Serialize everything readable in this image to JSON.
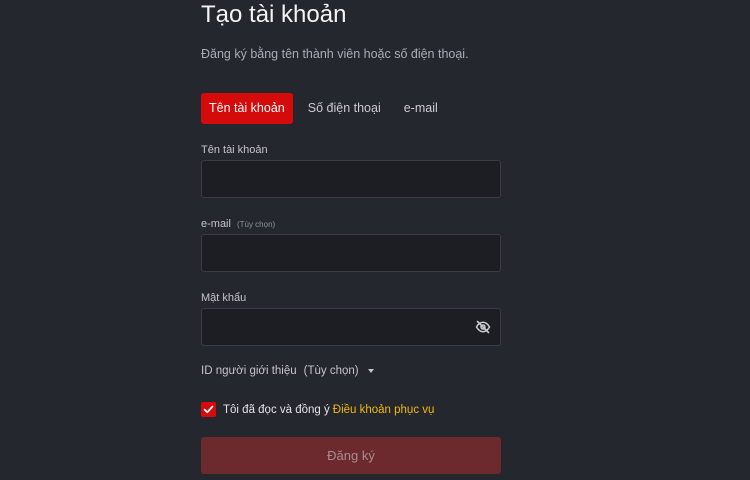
{
  "form": {
    "title": "Tạo tài khoản",
    "subtitle": "Đăng ký bằng tên thành viên hoặc số điện thoại.",
    "tabs": [
      {
        "label": "Tên tài khoản",
        "active": true
      },
      {
        "label": "Số điện thoại",
        "active": false
      },
      {
        "label": "e-mail",
        "active": false
      }
    ],
    "username": {
      "label": "Tên tài khoản",
      "value": "",
      "placeholder": ""
    },
    "email": {
      "label": "e-mail",
      "optional": "(Tùy chọn)",
      "value": "",
      "placeholder": ""
    },
    "password": {
      "label": "Mật khẩu",
      "value": "",
      "placeholder": "",
      "toggle_icon": "eye-off-icon"
    },
    "referral": {
      "label": "ID người giới thiệu",
      "optional": "(Tùy chọn)",
      "icon": "caret-down-icon"
    },
    "agree": {
      "checked": true,
      "text": "Tôi đã đọc và đồng ý",
      "link": "Điều khoản phục vụ"
    },
    "submit_label": "Đăng ký"
  },
  "colors": {
    "background": "#25272e",
    "input_bg": "#1c1e24",
    "accent": "#d50b0b",
    "link": "#f0b90b",
    "submit_disabled": "#6d2a2e"
  }
}
